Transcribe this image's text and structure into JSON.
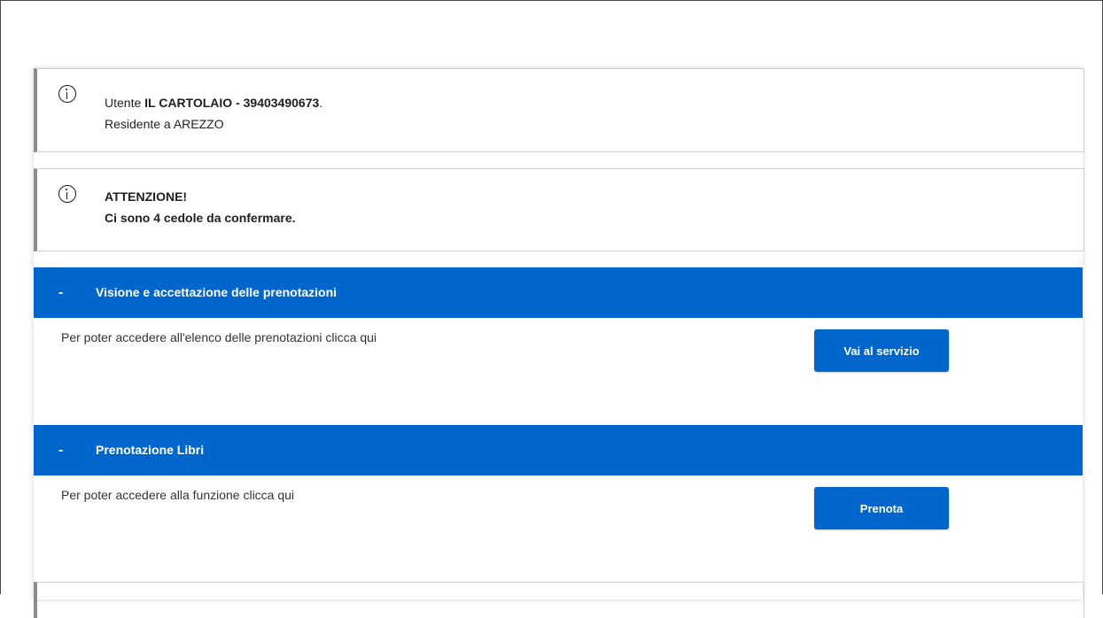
{
  "user_info": {
    "prefix": "Utente ",
    "name": "IL CARTOLAIO - 39403490673",
    "suffix": ".",
    "residence": "Residente a AREZZO",
    "icon": "info-icon"
  },
  "warning": {
    "title": "ATTENZIONE!",
    "message": "Ci sono 4 cedole da confermare.",
    "icon": "info-icon"
  },
  "sections": [
    {
      "toggle": "-",
      "title": "Visione e accettazione delle prenotazioni",
      "description": "Per poter accedere all'elenco delle prenotazioni clicca qui",
      "button_label": "Vai al servizio"
    },
    {
      "toggle": "-",
      "title": "Prenotazione Libri",
      "description": "Per poter accedere alla funzione clicca qui",
      "button_label": "Prenota"
    }
  ],
  "colors": {
    "primary": "#0066cc",
    "callout_border": "#8c8c8c"
  }
}
